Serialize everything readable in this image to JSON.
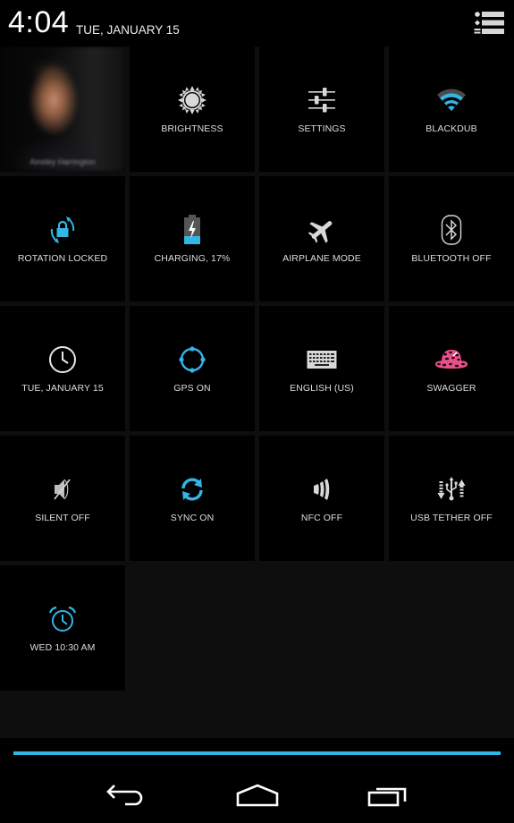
{
  "status": {
    "time": "4:04",
    "date": "TUE, JANUARY 15"
  },
  "header": {
    "settings_toggle_icon": "quick-settings-list-icon"
  },
  "user_tile": {
    "name": "Ainsley Harrington",
    "icon": "user-photo"
  },
  "tiles": [
    {
      "label": "BRIGHTNESS",
      "icon": "brightness-icon",
      "active": false
    },
    {
      "label": "SETTINGS",
      "icon": "settings-sliders-icon",
      "active": false
    },
    {
      "label": "BLACKDUB",
      "icon": "wifi-icon",
      "active": true
    },
    {
      "label": "ROTATION LOCKED",
      "icon": "rotation-lock-icon",
      "active": true
    },
    {
      "label": "CHARGING, 17%",
      "icon": "battery-charging-icon",
      "active": true,
      "battery_percent": 17
    },
    {
      "label": "AIRPLANE MODE",
      "icon": "airplane-icon",
      "active": false
    },
    {
      "label": "BLUETOOTH OFF",
      "icon": "bluetooth-icon",
      "active": false
    },
    {
      "label": "TUE, JANUARY 15",
      "icon": "clock-icon",
      "active": false
    },
    {
      "label": "GPS ON",
      "icon": "gps-icon",
      "active": true
    },
    {
      "label": "ENGLISH (US)",
      "icon": "keyboard-icon",
      "active": false
    },
    {
      "label": "SWAGGER",
      "icon": "leopard-hat-icon",
      "active": false
    },
    {
      "label": "SILENT OFF",
      "icon": "silent-icon",
      "active": false
    },
    {
      "label": "SYNC ON",
      "icon": "sync-icon",
      "active": true
    },
    {
      "label": "NFC OFF",
      "icon": "nfc-icon",
      "active": false
    },
    {
      "label": "USB TETHER OFF",
      "icon": "usb-tether-icon",
      "active": false
    },
    {
      "label": "WED 10:30 AM",
      "icon": "alarm-icon",
      "active": true
    }
  ],
  "navbar": {
    "back": "back-icon",
    "home": "home-icon",
    "recents": "recents-icon"
  },
  "colors": {
    "accent": "#33b5e5",
    "icon_default": "#d8d8d8",
    "tile_bg": "#000000",
    "panel_bg": "#0e0e0e"
  }
}
